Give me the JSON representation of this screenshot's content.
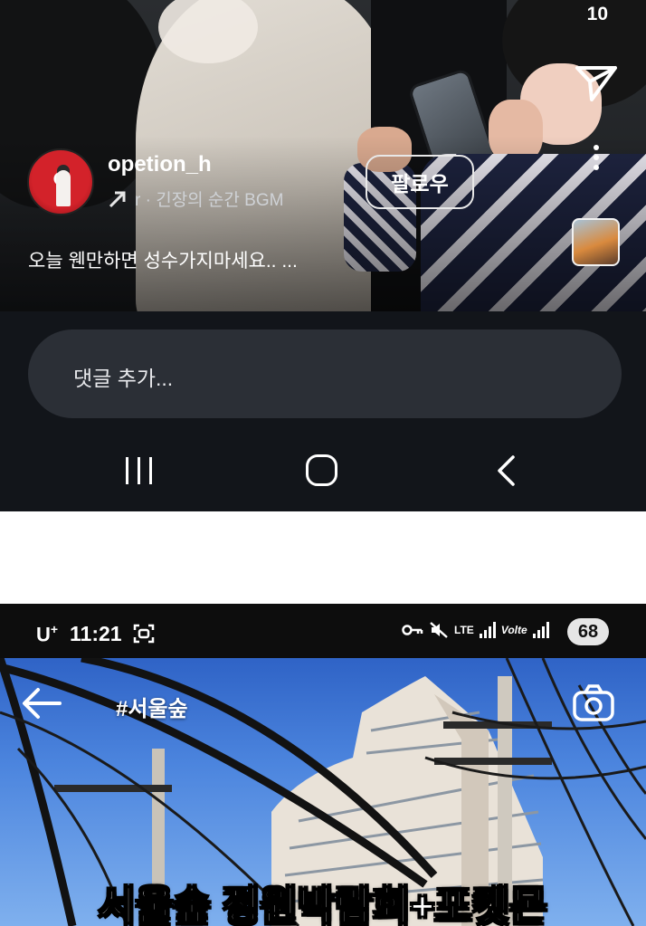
{
  "reel": {
    "count": "10",
    "username": "opetion_h",
    "music_text": "r · 긴장의 순간    BGM ",
    "follow_label": "팔로우",
    "caption": "오늘 웬만하면 성수가지마세요.. ...",
    "comment_placeholder": "댓글 추가..."
  },
  "statusbar": {
    "carrier": "U",
    "carrier_sup": "+",
    "time": "11:21",
    "network_label_1": "LTE",
    "network_label_2": "Volte",
    "battery": "68"
  },
  "post": {
    "hashtag": "#서울숲",
    "banner": "서울숲 정원박람회+포켓몬"
  },
  "icons": {
    "send": "send-icon",
    "more": "more-vert-icon",
    "music_arrow": "arrow-up-right-icon",
    "recents": "recents-icon",
    "home": "home-icon",
    "back": "back-icon",
    "screenshot": "screenshot-icon",
    "key": "key-icon",
    "mute": "mute-icon",
    "signal": "signal-icon",
    "camera": "camera-icon"
  },
  "colors": {
    "background_dark": "#12151a",
    "comment_box": "#2b2f36",
    "sky": "#4c85de",
    "avatar_red": "#d3222a"
  }
}
